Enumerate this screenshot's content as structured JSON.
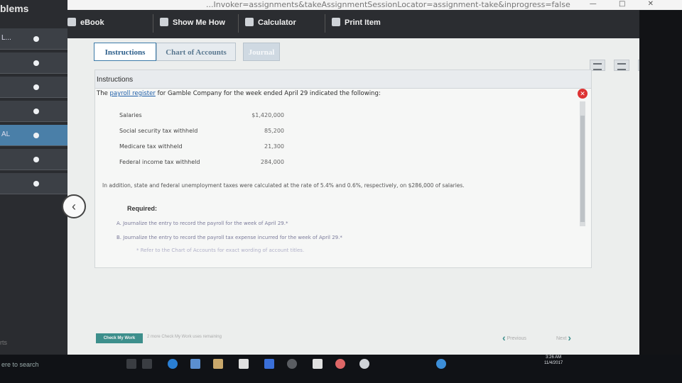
{
  "browser": {
    "url": "...Invoker=assignments&takeAssignmentSessionLocator=assignment-take&inprogress=false",
    "window_controls": [
      "—",
      "□",
      "✕"
    ]
  },
  "rail": {
    "title": "blems",
    "rows": [
      {
        "label": "L...",
        "active": false
      },
      {
        "label": "",
        "active": false
      },
      {
        "label": "",
        "active": false
      },
      {
        "label": "",
        "active": false
      },
      {
        "label": "AL",
        "active": true
      },
      {
        "label": "",
        "active": false
      },
      {
        "label": "",
        "active": false
      }
    ],
    "bottom_label": "rts"
  },
  "toolbar": {
    "ebook": "eBook",
    "show_me_how": "Show Me How",
    "calculator": "Calculator",
    "print_item": "Print Item"
  },
  "tabs": {
    "instructions": "Instructions",
    "chart_of_accounts": "Chart of Accounts",
    "journal": "Journal"
  },
  "instructions": {
    "heading": "Instructions",
    "intro_prefix": "The ",
    "intro_link": "payroll register",
    "intro_suffix": " for Gamble Company for the week ended April 29 indicated the following:",
    "rows": [
      {
        "label": "Salaries",
        "value": "$1,420,000"
      },
      {
        "label": "Social security tax withheld",
        "value": "85,200"
      },
      {
        "label": "Medicare tax withheld",
        "value": "21,300"
      },
      {
        "label": "Federal income tax withheld",
        "value": "284,000"
      }
    ],
    "additional": "In addition, state and federal unemployment taxes were calculated at the rate of 5.4% and 0.6%, respectively, on $286,000 of salaries.",
    "required_title": "Required:",
    "required_a": "A. Journalize the entry to record the payroll for the week of April 29.*",
    "required_b": "B. Journalize the entry to record the payroll tax expense incurred for the week of April 29.*",
    "note": "* Refer to the Chart of Accounts for exact wording of account titles."
  },
  "footer": {
    "check_my_work": "Check My Work",
    "check_note": "2 more Check My Work uses remaining",
    "previous": "Previous",
    "next": "Next"
  },
  "taskbar": {
    "search": "ere to search",
    "clock_time": "3:26 AM",
    "clock_date": "11/4/2017"
  }
}
